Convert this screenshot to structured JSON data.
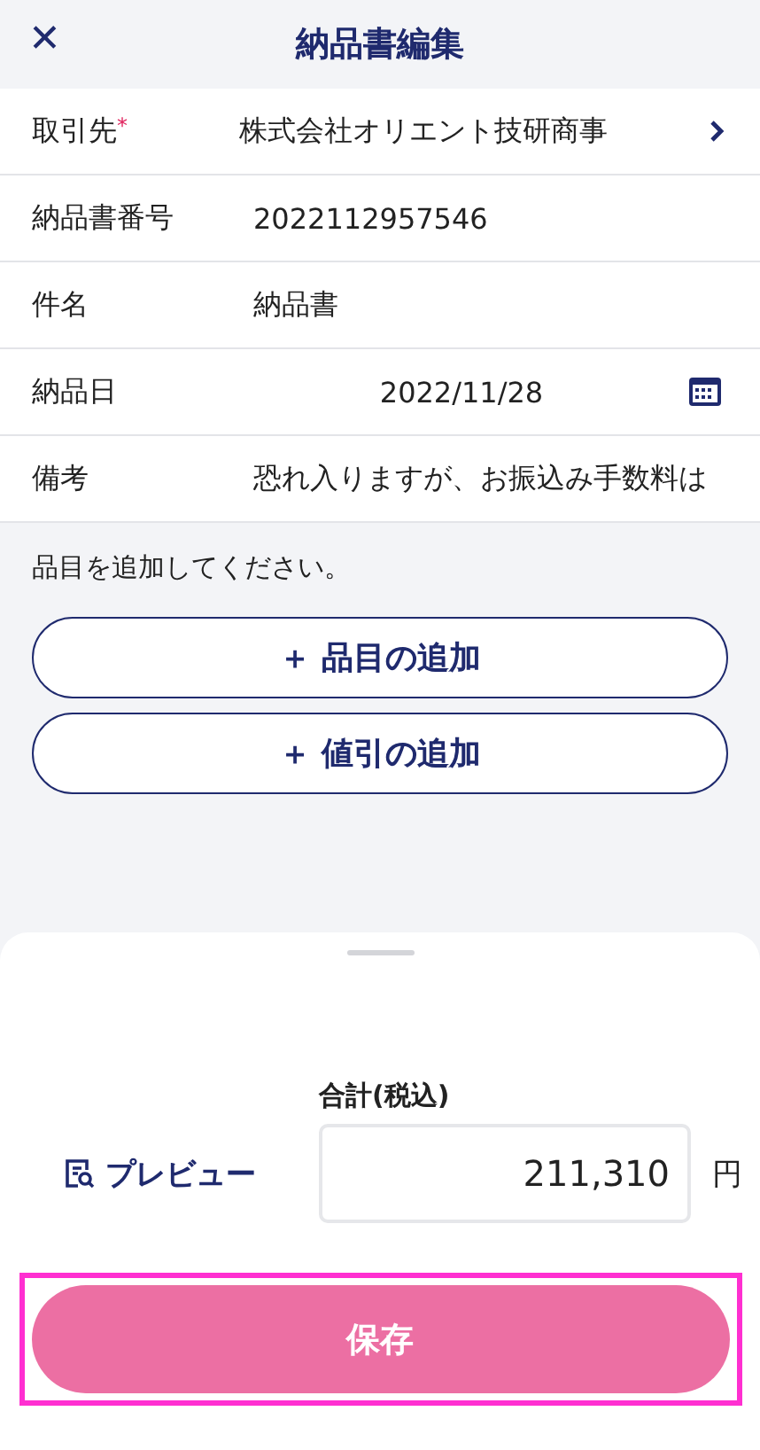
{
  "header": {
    "close_icon": "✕",
    "title": "納品書編集"
  },
  "fields": [
    {
      "kind": "link",
      "label": "取引先",
      "required": true,
      "value": "株式会社オリエント技研商事"
    },
    {
      "kind": "text",
      "label": "納品書番号",
      "required": false,
      "value": "2022112957546"
    },
    {
      "kind": "text",
      "label": "件名",
      "required": false,
      "value": "納品書"
    },
    {
      "kind": "date",
      "label": "納品日",
      "required": false,
      "value": "2022/11/28"
    },
    {
      "kind": "text",
      "label": "備考",
      "required": false,
      "value": "恐れ入りますが、お振込み手数料は"
    }
  ],
  "required_mark": "*",
  "hint": "品目を追加してください。",
  "add_buttons": [
    {
      "icon": "＋",
      "label": "品目の追加"
    },
    {
      "icon": "＋",
      "label": "値引の追加"
    }
  ],
  "summary": {
    "preview": "プレビュー",
    "total_label": "合計(税込)",
    "total_value": "211,310",
    "currency": "円"
  },
  "save_button": {
    "label": "保存",
    "highlighted": true
  }
}
